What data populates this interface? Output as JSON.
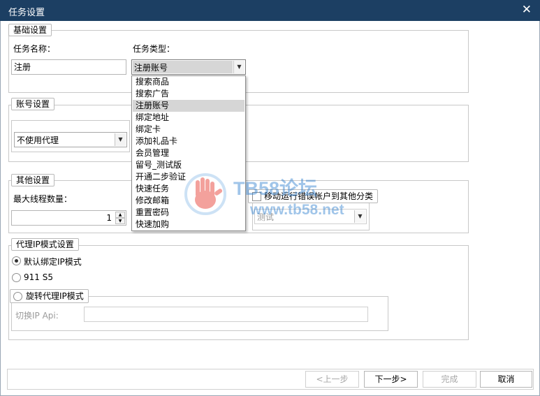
{
  "window": {
    "title": "任务设置"
  },
  "basic": {
    "legend": "基础设置",
    "name_label": "任务名称：",
    "name_value": "注册",
    "type_label": "任务类型：",
    "type_value": "注册账号",
    "type_options": [
      "搜索商品",
      "搜索广告",
      "注册账号",
      "绑定地址",
      "绑定卡",
      "添加礼品卡",
      "会员管理",
      "留号_测试版",
      "开通二步验证",
      "快速任务",
      "修改邮箱",
      "重置密码",
      "快速加购"
    ],
    "type_selected_index": 2
  },
  "account": {
    "legend": "账号设置",
    "proxy_value": "不使用代理"
  },
  "other": {
    "legend": "其他设置",
    "threads_label": "最大线程数量：",
    "threads_value": "1",
    "move_error_label": "移动运行错误帐户到其他分类",
    "move_error_checked": false,
    "category_value": "测试"
  },
  "proxy_ip": {
    "legend": "代理IP模式设置",
    "mode_default": "默认绑定IP模式",
    "mode_911": "911 S5",
    "mode_rotate": "旋转代理IP模式",
    "selected_mode": "default",
    "switch_api_label": "切换IP Api:",
    "switch_api_value": ""
  },
  "footer": {
    "prev": "<上一步",
    "next": "下一步>",
    "finish": "完成",
    "cancel": "取消"
  },
  "watermark": {
    "brand": "TB58论坛",
    "url": "www.tb58.net"
  },
  "colors": {
    "titlebar": "#1c3f63",
    "watermark": "#2f7fd0",
    "hand": "#e8453c"
  }
}
